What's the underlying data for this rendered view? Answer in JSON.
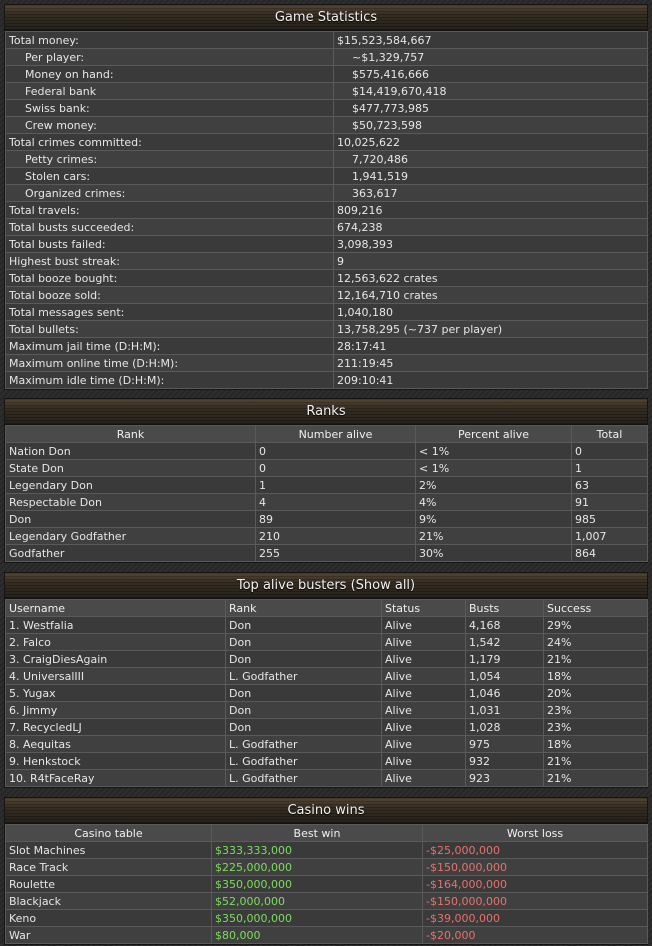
{
  "game_stats": {
    "title": "Game Statistics",
    "rows": [
      {
        "label": "Total money:",
        "value": "$15,523,584,667",
        "sub": false
      },
      {
        "label": "Per player:",
        "value": "~$1,329,757",
        "sub": true
      },
      {
        "label": "Money on hand:",
        "value": "$575,416,666",
        "sub": true
      },
      {
        "label": "Federal bank",
        "value": "$14,419,670,418",
        "sub": true
      },
      {
        "label": "Swiss bank:",
        "value": "$477,773,985",
        "sub": true
      },
      {
        "label": "Crew money:",
        "value": "$50,723,598",
        "sub": true
      },
      {
        "label": "Total crimes committed:",
        "value": "10,025,622",
        "sub": false
      },
      {
        "label": "Petty crimes:",
        "value": "7,720,486",
        "sub": true
      },
      {
        "label": "Stolen cars:",
        "value": "1,941,519",
        "sub": true
      },
      {
        "label": "Organized crimes:",
        "value": "363,617",
        "sub": true
      },
      {
        "label": "Total travels:",
        "value": "809,216",
        "sub": false
      },
      {
        "label": "Total busts succeeded:",
        "value": "674,238",
        "sub": false
      },
      {
        "label": "Total busts failed:",
        "value": "3,098,393",
        "sub": false
      },
      {
        "label": "Highest bust streak:",
        "value": "9",
        "sub": false
      },
      {
        "label": "Total booze bought:",
        "value": "12,563,622 crates",
        "sub": false
      },
      {
        "label": "Total booze sold:",
        "value": "12,164,710 crates",
        "sub": false
      },
      {
        "label": "Total messages sent:",
        "value": "1,040,180",
        "sub": false
      },
      {
        "label": "Total bullets:",
        "value": "13,758,295 (~737 per player)",
        "sub": false
      },
      {
        "label": "Maximum jail time (D:H:M):",
        "value": "28:17:41",
        "sub": false
      },
      {
        "label": "Maximum online time (D:H:M):",
        "value": "211:19:45",
        "sub": false
      },
      {
        "label": "Maximum idle time (D:H:M):",
        "value": "209:10:41",
        "sub": false
      }
    ]
  },
  "ranks": {
    "title": "Ranks",
    "headers": [
      "Rank",
      "Number alive",
      "Percent alive",
      "Total"
    ],
    "rows": [
      [
        "Nation Don",
        "0",
        "< 1%",
        "0"
      ],
      [
        "State Don",
        "0",
        "< 1%",
        "1"
      ],
      [
        "Legendary Don",
        "1",
        "2%",
        "63"
      ],
      [
        "Respectable Don",
        "4",
        "4%",
        "91"
      ],
      [
        "Don",
        "89",
        "9%",
        "985"
      ],
      [
        "Legendary Godfather",
        "210",
        "21%",
        "1,007"
      ],
      [
        "Godfather",
        "255",
        "30%",
        "864"
      ]
    ]
  },
  "busters": {
    "title": "Top alive busters (Show all)",
    "headers": [
      "Username",
      "Rank",
      "Status",
      "Busts",
      "Success"
    ],
    "rows": [
      [
        "1. Westfalia",
        "Don",
        "Alive",
        "4,168",
        "29%"
      ],
      [
        "2. Falco",
        "Don",
        "Alive",
        "1,542",
        "24%"
      ],
      [
        "3. CraigDiesAgain",
        "Don",
        "Alive",
        "1,179",
        "21%"
      ],
      [
        "4. UniversalIII",
        "L. Godfather",
        "Alive",
        "1,054",
        "18%"
      ],
      [
        "5. Yugax",
        "Don",
        "Alive",
        "1,046",
        "20%"
      ],
      [
        "6. Jimmy",
        "Don",
        "Alive",
        "1,031",
        "23%"
      ],
      [
        "7. RecycledLJ",
        "Don",
        "Alive",
        "1,028",
        "23%"
      ],
      [
        "8. Aequitas",
        "L. Godfather",
        "Alive",
        "975",
        "18%"
      ],
      [
        "9. Henkstock",
        "L. Godfather",
        "Alive",
        "932",
        "21%"
      ],
      [
        "10. R4tFaceRay",
        "L. Godfather",
        "Alive",
        "923",
        "21%"
      ]
    ]
  },
  "casino": {
    "title": "Casino wins",
    "headers": [
      "Casino table",
      "Best win",
      "Worst loss"
    ],
    "rows": [
      [
        "Slot Machines",
        "$333,333,000",
        "-$25,000,000"
      ],
      [
        "Race Track",
        "$225,000,000",
        "-$150,000,000"
      ],
      [
        "Roulette",
        "$350,000,000",
        "-$164,000,000"
      ],
      [
        "Blackjack",
        "$52,000,000",
        "-$150,000,000"
      ],
      [
        "Keno",
        "$350,000,000",
        "-$39,000,000"
      ],
      [
        "War",
        "$80,000",
        "-$20,000"
      ]
    ]
  },
  "colors": {
    "win": "#7cdd5c",
    "loss": "#e8726a"
  }
}
